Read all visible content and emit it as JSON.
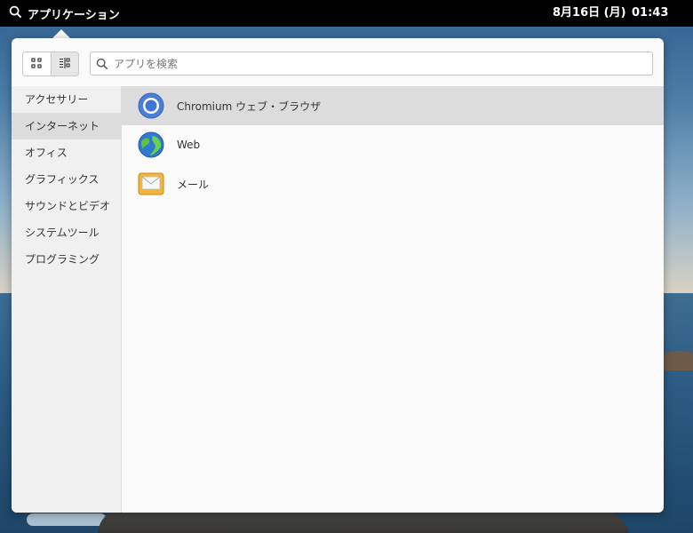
{
  "topbar": {
    "applications_label": "アプリケーション",
    "date": "8月16日 (月)",
    "time": "01:43"
  },
  "search": {
    "placeholder": "アプリを検索",
    "value": ""
  },
  "categories": [
    "アクセサリー",
    "インターネット",
    "オフィス",
    "グラフィックス",
    "サウンドとビデオ",
    "システムツール",
    "プログラミング"
  ],
  "selected_category": "インターネット",
  "apps": [
    {
      "name": "Chromium ウェブ・ブラウザ",
      "icon": "chromium-icon"
    },
    {
      "name": "Web",
      "icon": "globe-icon"
    },
    {
      "name": "メール",
      "icon": "mail-icon"
    }
  ],
  "selected_app": "Chromium ウェブ・ブラウザ",
  "view_modes": [
    "grid-view",
    "category-view"
  ],
  "active_view": "category-view",
  "colors": {
    "topbar": "#000000",
    "selection": "#dcdcdc",
    "panel": "#fafafa"
  }
}
